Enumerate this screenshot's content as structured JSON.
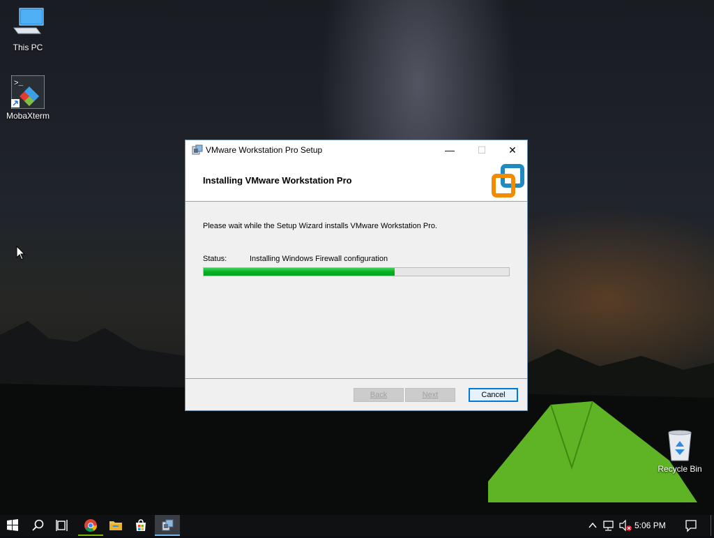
{
  "desktop": {
    "icons": [
      {
        "label": "This PC",
        "icon": "computer-icon"
      },
      {
        "label": "MobaXterm",
        "icon": "mobaxterm-icon"
      },
      {
        "label": "Recycle Bin",
        "icon": "recycle-bin-icon"
      }
    ]
  },
  "dialog": {
    "title": "VMware Workstation Pro Setup",
    "heading": "Installing VMware Workstation Pro",
    "description": "Please wait while the Setup Wizard installs VMware Workstation Pro.",
    "status_label": "Status:",
    "status_value": "Installing Windows Firewall configuration",
    "progress_fraction": 0.625,
    "buttons": {
      "back": "Back",
      "next": "Next",
      "cancel": "Cancel"
    },
    "window_controls": {
      "minimize": "—",
      "maximize": "☐",
      "close": "✕"
    }
  },
  "taskbar": {
    "clock": "5:06 PM",
    "items": [
      "start-icon",
      "search-icon",
      "task-view-icon",
      "chrome-icon",
      "file-explorer-icon",
      "store-icon",
      "vmware-setup-icon"
    ],
    "accent": "#76b9ed"
  },
  "colors": {
    "progress_fill": "#06b025",
    "focus_border": "#0078d7",
    "logo_orange": "#f38b00",
    "logo_blue": "#1d8ac0"
  }
}
